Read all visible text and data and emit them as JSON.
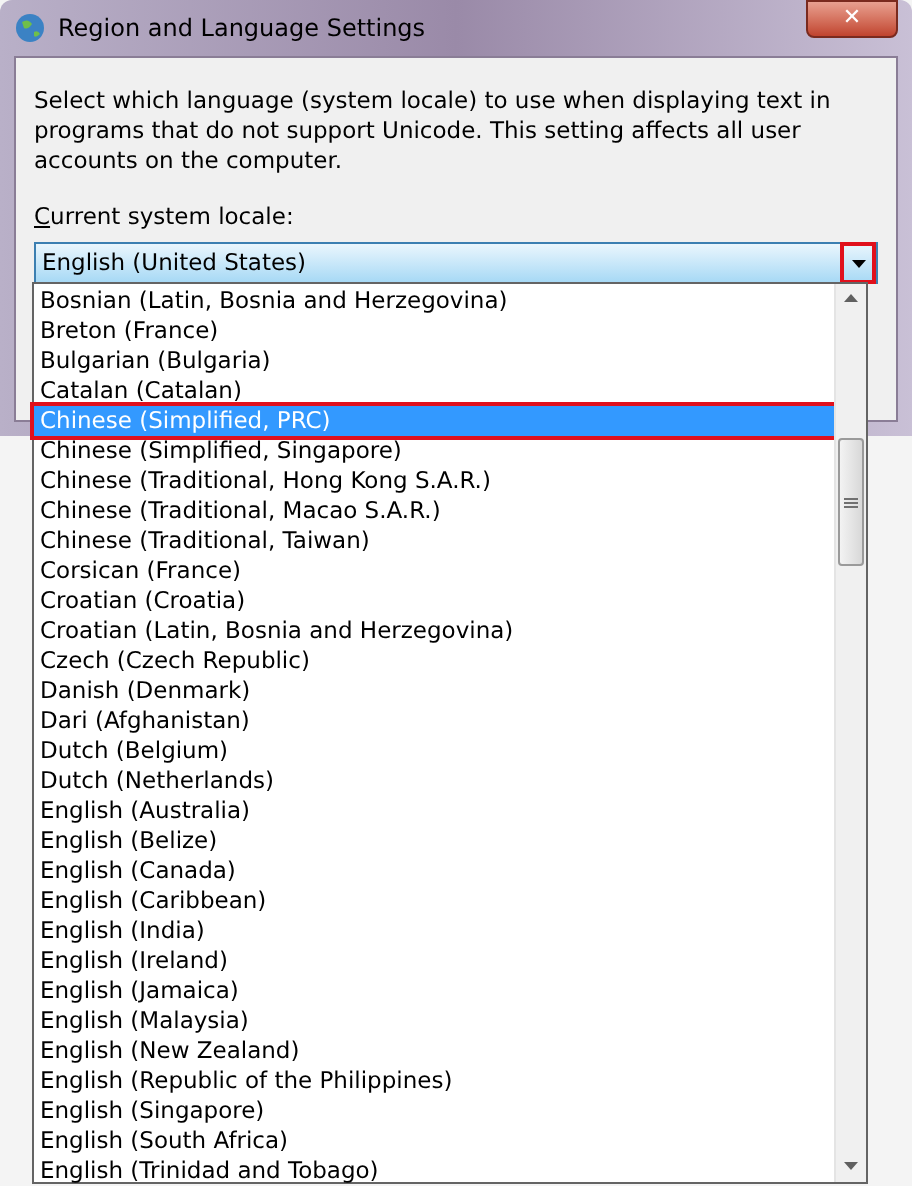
{
  "window": {
    "title": "Region and Language Settings",
    "close": "✕"
  },
  "description": "Select which language (system locale) to use when displaying text in programs that do not support Unicode. This setting affects all user accounts on the computer.",
  "locale_label": "Current system locale:",
  "combobox": {
    "value": "English (United States)",
    "expanded": true,
    "button_outlined": true
  },
  "dropdown": {
    "items": [
      {
        "label": "Bosnian (Latin, Bosnia and Herzegovina)",
        "selected": false,
        "outlined": false
      },
      {
        "label": "Breton (France)",
        "selected": false,
        "outlined": false
      },
      {
        "label": "Bulgarian (Bulgaria)",
        "selected": false,
        "outlined": false
      },
      {
        "label": "Catalan (Catalan)",
        "selected": false,
        "outlined": false
      },
      {
        "label": "Chinese (Simplified, PRC)",
        "selected": true,
        "outlined": true
      },
      {
        "label": "Chinese (Simplified, Singapore)",
        "selected": false,
        "outlined": false
      },
      {
        "label": "Chinese (Traditional, Hong Kong S.A.R.)",
        "selected": false,
        "outlined": false
      },
      {
        "label": "Chinese (Traditional, Macao S.A.R.)",
        "selected": false,
        "outlined": false
      },
      {
        "label": "Chinese (Traditional, Taiwan)",
        "selected": false,
        "outlined": false
      },
      {
        "label": "Corsican (France)",
        "selected": false,
        "outlined": false
      },
      {
        "label": "Croatian (Croatia)",
        "selected": false,
        "outlined": false
      },
      {
        "label": "Croatian (Latin, Bosnia and Herzegovina)",
        "selected": false,
        "outlined": false
      },
      {
        "label": "Czech (Czech Republic)",
        "selected": false,
        "outlined": false
      },
      {
        "label": "Danish (Denmark)",
        "selected": false,
        "outlined": false
      },
      {
        "label": "Dari (Afghanistan)",
        "selected": false,
        "outlined": false
      },
      {
        "label": "Dutch (Belgium)",
        "selected": false,
        "outlined": false
      },
      {
        "label": "Dutch (Netherlands)",
        "selected": false,
        "outlined": false
      },
      {
        "label": "English (Australia)",
        "selected": false,
        "outlined": false
      },
      {
        "label": "English (Belize)",
        "selected": false,
        "outlined": false
      },
      {
        "label": "English (Canada)",
        "selected": false,
        "outlined": false
      },
      {
        "label": "English (Caribbean)",
        "selected": false,
        "outlined": false
      },
      {
        "label": "English (India)",
        "selected": false,
        "outlined": false
      },
      {
        "label": "English (Ireland)",
        "selected": false,
        "outlined": false
      },
      {
        "label": "English (Jamaica)",
        "selected": false,
        "outlined": false
      },
      {
        "label": "English (Malaysia)",
        "selected": false,
        "outlined": false
      },
      {
        "label": "English (New Zealand)",
        "selected": false,
        "outlined": false
      },
      {
        "label": "English (Republic of the Philippines)",
        "selected": false,
        "outlined": false
      },
      {
        "label": "English (Singapore)",
        "selected": false,
        "outlined": false
      },
      {
        "label": "English (South Africa)",
        "selected": false,
        "outlined": false
      },
      {
        "label": "English (Trinidad and Tobago)",
        "selected": false,
        "outlined": false
      }
    ]
  }
}
